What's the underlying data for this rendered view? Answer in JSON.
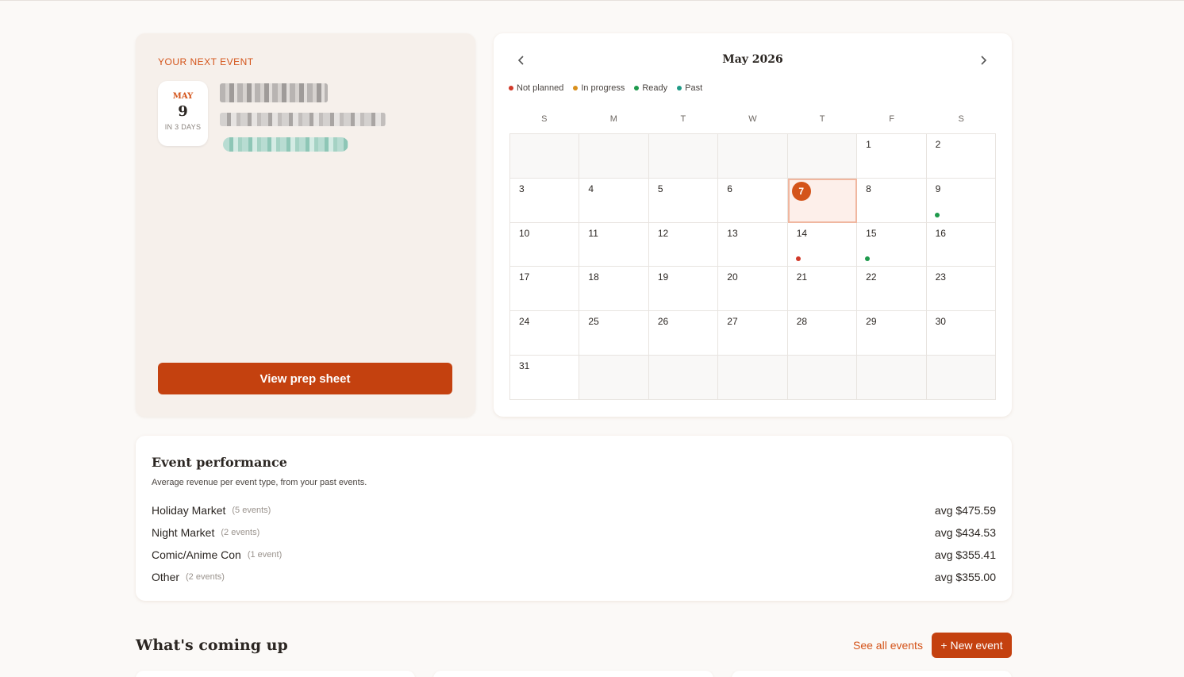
{
  "next_event": {
    "label": "YOUR NEXT EVENT",
    "month": "MAY",
    "day": "9",
    "relative": "IN 3 DAYS",
    "button_label": "View prep sheet"
  },
  "calendar": {
    "title": "May 2026",
    "legend": [
      {
        "label": "Not planned",
        "color": "#d13a2a"
      },
      {
        "label": "In progress",
        "color": "#d9901c"
      },
      {
        "label": "Ready",
        "color": "#1e9a4c"
      },
      {
        "label": "Past",
        "color": "#1f9a86"
      }
    ],
    "weekdays": [
      "S",
      "M",
      "T",
      "W",
      "T",
      "F",
      "S"
    ],
    "leading_empty": 5,
    "days_in_month": 31,
    "today": 7,
    "event_dots": {
      "9": "Ready",
      "14": "Not planned",
      "15": "Ready"
    }
  },
  "performance": {
    "title": "Event performance",
    "subtitle": "Average revenue per event type, from your past events.",
    "rows": [
      {
        "name": "Holiday Market",
        "count": "(5 events)",
        "value": "avg $475.59"
      },
      {
        "name": "Night Market",
        "count": "(2 events)",
        "value": "avg $434.53"
      },
      {
        "name": "Comic/Anime Con",
        "count": "(1 event)",
        "value": "avg $355.41"
      },
      {
        "name": "Other",
        "count": "(2 events)",
        "value": "avg $355.00"
      }
    ]
  },
  "coming_up": {
    "title": "What's coming up",
    "see_all": "See all events",
    "new_event": "+ New event"
  }
}
